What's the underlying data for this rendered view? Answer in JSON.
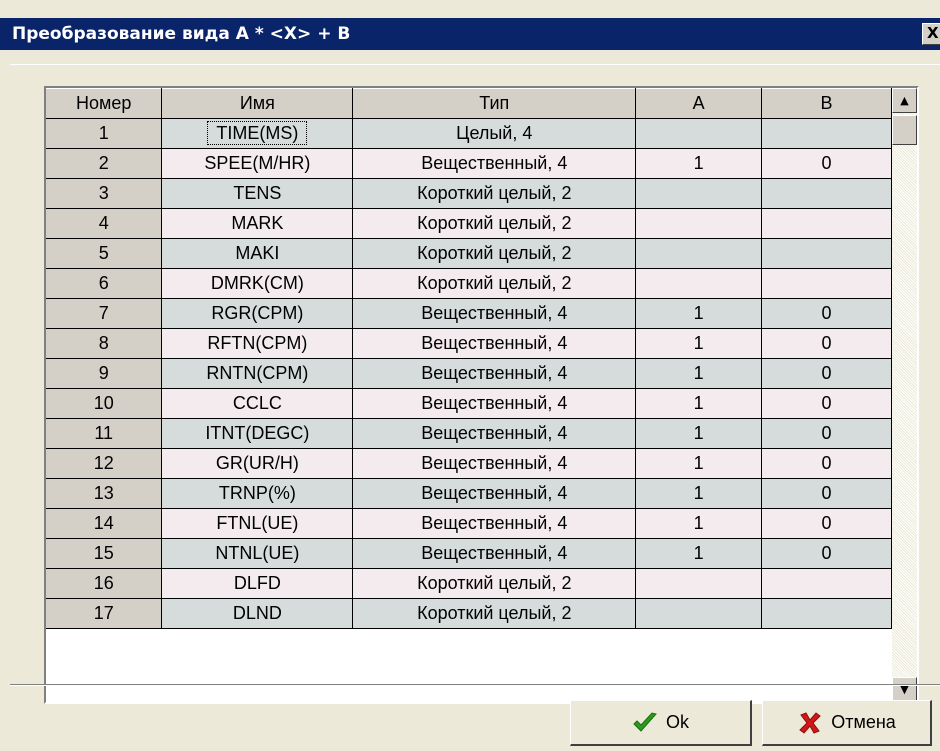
{
  "window": {
    "title": "Преобразование вида  A * <X> + B",
    "close_label": "X"
  },
  "grid": {
    "columns": [
      "Номер",
      "Имя",
      "Тип",
      "A",
      "B"
    ],
    "rows": [
      {
        "num": "1",
        "name": "TIME(MS)",
        "type": "Целый, 4",
        "a": "",
        "b": ""
      },
      {
        "num": "2",
        "name": "SPEE(M/HR)",
        "type": "Вещественный, 4",
        "a": "1",
        "b": "0"
      },
      {
        "num": "3",
        "name": "TENS",
        "type": "Короткий целый, 2",
        "a": "",
        "b": ""
      },
      {
        "num": "4",
        "name": "MARK",
        "type": "Короткий целый, 2",
        "a": "",
        "b": ""
      },
      {
        "num": "5",
        "name": "MAKI",
        "type": "Короткий целый, 2",
        "a": "",
        "b": ""
      },
      {
        "num": "6",
        "name": "DMRK(CM)",
        "type": "Короткий целый, 2",
        "a": "",
        "b": ""
      },
      {
        "num": "7",
        "name": "RGR(CPM)",
        "type": "Вещественный, 4",
        "a": "1",
        "b": "0"
      },
      {
        "num": "8",
        "name": "RFTN(CPM)",
        "type": "Вещественный, 4",
        "a": "1",
        "b": "0"
      },
      {
        "num": "9",
        "name": "RNTN(CPM)",
        "type": "Вещественный, 4",
        "a": "1",
        "b": "0"
      },
      {
        "num": "10",
        "name": "CCLC",
        "type": "Вещественный, 4",
        "a": "1",
        "b": "0"
      },
      {
        "num": "11",
        "name": "ITNT(DEGC)",
        "type": "Вещественный, 4",
        "a": "1",
        "b": "0"
      },
      {
        "num": "12",
        "name": "GR(UR/H)",
        "type": "Вещественный, 4",
        "a": "1",
        "b": "0"
      },
      {
        "num": "13",
        "name": "TRNP(%)",
        "type": "Вещественный, 4",
        "a": "1",
        "b": "0"
      },
      {
        "num": "14",
        "name": "FTNL(UE)",
        "type": "Вещественный, 4",
        "a": "1",
        "b": "0"
      },
      {
        "num": "15",
        "name": "NTNL(UE)",
        "type": "Вещественный, 4",
        "a": "1",
        "b": "0"
      },
      {
        "num": "16",
        "name": "DLFD",
        "type": "Короткий целый, 2",
        "a": "",
        "b": ""
      },
      {
        "num": "17",
        "name": "DLND",
        "type": "Короткий целый, 2",
        "a": "",
        "b": ""
      }
    ],
    "focused_row": 0
  },
  "scrollbar": {
    "up_icon": "scroll-up-arrow-icon",
    "down_icon": "scroll-down-arrow-icon"
  },
  "buttons": {
    "ok_label": "Ok",
    "ok_icon": "green-checkmark-icon",
    "ok_icon_color": "#2c9a1c",
    "cancel_label": "Отмена",
    "cancel_icon": "red-x-icon",
    "cancel_icon_color": "#d01818"
  },
  "colors": {
    "titlebar": "#0a246a",
    "row_odd": "#d6dbdc",
    "row_even": "#f3ebee",
    "header": "#d4d0c8"
  }
}
